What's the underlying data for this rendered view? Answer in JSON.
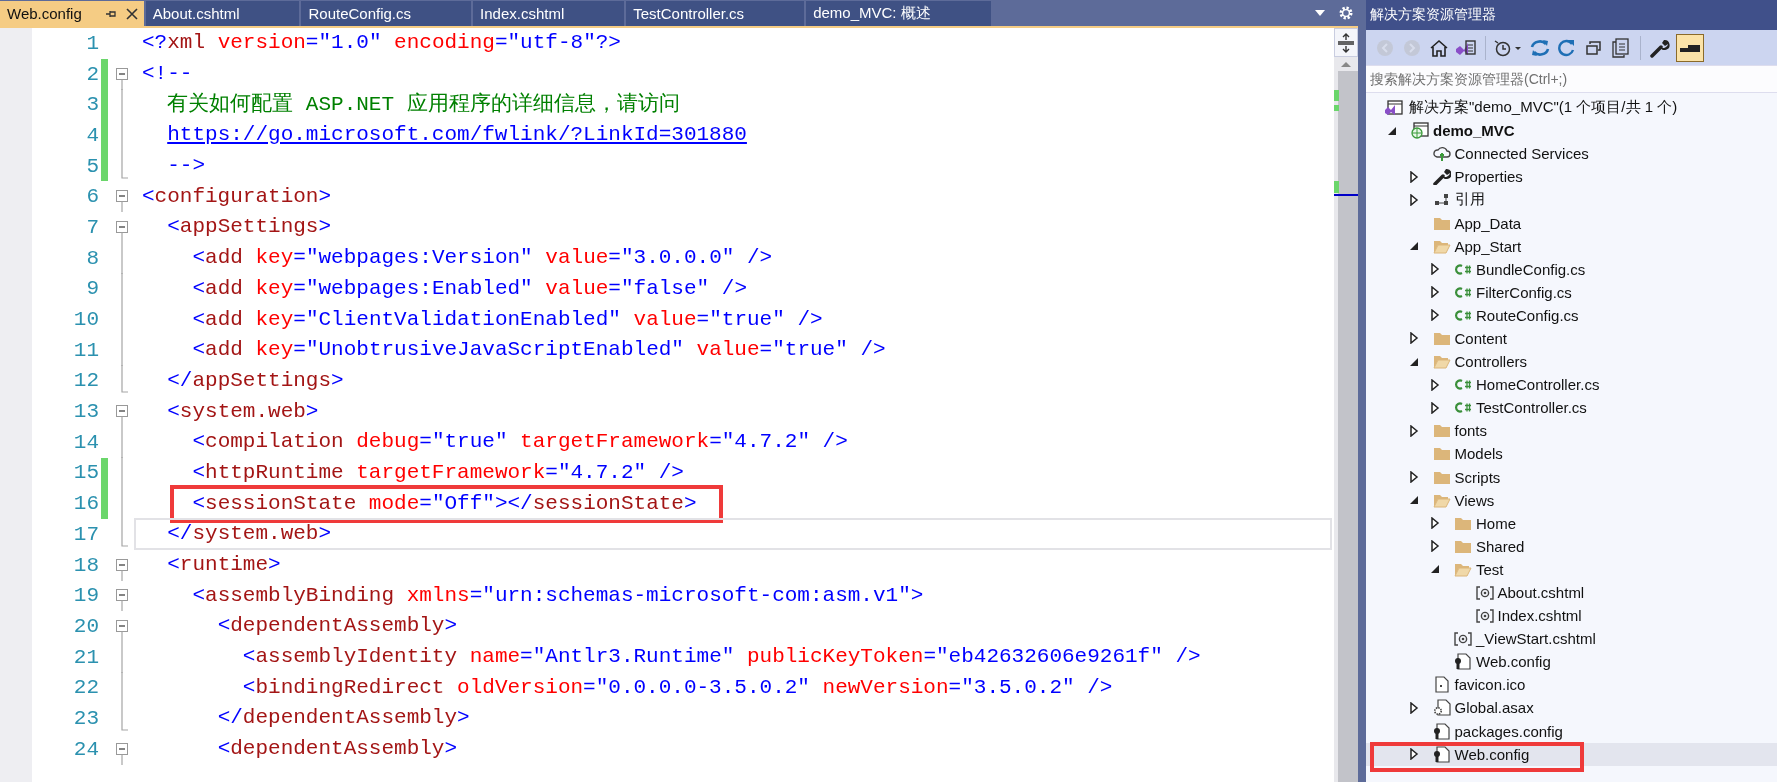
{
  "tabs": [
    {
      "label": "Web.config",
      "selected": true
    },
    {
      "label": "About.cshtml",
      "selected": false
    },
    {
      "label": "RouteConfig.cs",
      "selected": false
    },
    {
      "label": "Index.cshtml",
      "selected": false
    },
    {
      "label": "TestController.cs",
      "selected": false
    },
    {
      "label": "demo_MVC: 概述",
      "selected": false
    }
  ],
  "editor": {
    "lines": [
      {
        "number": "1",
        "changed": false,
        "kind": "plain",
        "current": false,
        "highlighted": false,
        "tokens": [
          {
            "kind": "delim",
            "text": "<?"
          },
          {
            "kind": "tag",
            "text": "xml"
          },
          {
            "kind": "attr",
            "text": " version"
          },
          {
            "kind": "delim",
            "text": "="
          },
          {
            "kind": "value",
            "text": "\"1.0\""
          },
          {
            "kind": "attr",
            "text": " encoding"
          },
          {
            "kind": "delim",
            "text": "="
          },
          {
            "kind": "value",
            "text": "\"utf-8\""
          },
          {
            "kind": "delim",
            "text": "?>"
          }
        ]
      },
      {
        "number": "2",
        "changed": true,
        "kind": "fold-start",
        "current": false,
        "highlighted": false,
        "tokens": [
          {
            "kind": "delim",
            "text": "<!--"
          }
        ]
      },
      {
        "number": "3",
        "changed": true,
        "kind": "fold-body",
        "current": false,
        "highlighted": false,
        "tokens": [
          {
            "kind": "comment",
            "text": "  有关如何配置 ASP.NET 应用程序的详细信息，请访问"
          }
        ]
      },
      {
        "number": "4",
        "changed": true,
        "kind": "fold-body",
        "current": false,
        "highlighted": false,
        "tokens": [
          {
            "kind": "link",
            "text": "  https://go.microsoft.com/fwlink/?LinkId=301880"
          }
        ]
      },
      {
        "number": "5",
        "changed": true,
        "kind": "fold-end",
        "current": false,
        "highlighted": false,
        "tokens": [
          {
            "kind": "delim",
            "text": "  -->"
          }
        ]
      },
      {
        "number": "6",
        "changed": false,
        "kind": "fold-start",
        "current": false,
        "highlighted": false,
        "tokens": [
          {
            "kind": "delim",
            "text": "<"
          },
          {
            "kind": "tag",
            "text": "configuration"
          },
          {
            "kind": "delim",
            "text": ">"
          }
        ]
      },
      {
        "number": "7",
        "changed": false,
        "kind": "fold-start",
        "current": false,
        "highlighted": false,
        "tokens": [
          {
            "kind": "delim",
            "text": "  <"
          },
          {
            "kind": "tag",
            "text": "appSettings"
          },
          {
            "kind": "delim",
            "text": ">"
          }
        ]
      },
      {
        "number": "8",
        "changed": false,
        "kind": "fold-body",
        "current": false,
        "highlighted": false,
        "tokens": [
          {
            "kind": "delim",
            "text": "    <"
          },
          {
            "kind": "tag",
            "text": "add"
          },
          {
            "kind": "attr",
            "text": " key"
          },
          {
            "kind": "delim",
            "text": "="
          },
          {
            "kind": "value",
            "text": "\"webpages:Version\""
          },
          {
            "kind": "attr",
            "text": " value"
          },
          {
            "kind": "delim",
            "text": "="
          },
          {
            "kind": "value",
            "text": "\"3.0.0.0\""
          },
          {
            "kind": "delim",
            "text": " />"
          }
        ]
      },
      {
        "number": "9",
        "changed": false,
        "kind": "fold-body",
        "current": false,
        "highlighted": false,
        "tokens": [
          {
            "kind": "delim",
            "text": "    <"
          },
          {
            "kind": "tag",
            "text": "add"
          },
          {
            "kind": "attr",
            "text": " key"
          },
          {
            "kind": "delim",
            "text": "="
          },
          {
            "kind": "value",
            "text": "\"webpages:Enabled\""
          },
          {
            "kind": "attr",
            "text": " value"
          },
          {
            "kind": "delim",
            "text": "="
          },
          {
            "kind": "value",
            "text": "\"false\""
          },
          {
            "kind": "delim",
            "text": " />"
          }
        ]
      },
      {
        "number": "10",
        "changed": false,
        "kind": "fold-body",
        "current": false,
        "highlighted": false,
        "tokens": [
          {
            "kind": "delim",
            "text": "    <"
          },
          {
            "kind": "tag",
            "text": "add"
          },
          {
            "kind": "attr",
            "text": " key"
          },
          {
            "kind": "delim",
            "text": "="
          },
          {
            "kind": "value",
            "text": "\"ClientValidationEnabled\""
          },
          {
            "kind": "attr",
            "text": " value"
          },
          {
            "kind": "delim",
            "text": "="
          },
          {
            "kind": "value",
            "text": "\"true\""
          },
          {
            "kind": "delim",
            "text": " />"
          }
        ]
      },
      {
        "number": "11",
        "changed": false,
        "kind": "fold-body",
        "current": false,
        "highlighted": false,
        "tokens": [
          {
            "kind": "delim",
            "text": "    <"
          },
          {
            "kind": "tag",
            "text": "add"
          },
          {
            "kind": "attr",
            "text": " key"
          },
          {
            "kind": "delim",
            "text": "="
          },
          {
            "kind": "value",
            "text": "\"UnobtrusiveJavaScriptEnabled\""
          },
          {
            "kind": "attr",
            "text": " value"
          },
          {
            "kind": "delim",
            "text": "="
          },
          {
            "kind": "value",
            "text": "\"true\""
          },
          {
            "kind": "delim",
            "text": " />"
          }
        ]
      },
      {
        "number": "12",
        "changed": false,
        "kind": "fold-end",
        "current": false,
        "highlighted": false,
        "tokens": [
          {
            "kind": "delim",
            "text": "  </"
          },
          {
            "kind": "tag",
            "text": "appSettings"
          },
          {
            "kind": "delim",
            "text": ">"
          }
        ]
      },
      {
        "number": "13",
        "changed": false,
        "kind": "fold-start",
        "current": false,
        "highlighted": false,
        "tokens": [
          {
            "kind": "delim",
            "text": "  <"
          },
          {
            "kind": "tag",
            "text": "system.web"
          },
          {
            "kind": "delim",
            "text": ">"
          }
        ]
      },
      {
        "number": "14",
        "changed": false,
        "kind": "fold-body",
        "current": false,
        "highlighted": false,
        "tokens": [
          {
            "kind": "delim",
            "text": "    <"
          },
          {
            "kind": "tag",
            "text": "compilation"
          },
          {
            "kind": "attr",
            "text": " debug"
          },
          {
            "kind": "delim",
            "text": "="
          },
          {
            "kind": "value",
            "text": "\"true\""
          },
          {
            "kind": "attr",
            "text": " targetFramework"
          },
          {
            "kind": "delim",
            "text": "="
          },
          {
            "kind": "value",
            "text": "\"4.7.2\""
          },
          {
            "kind": "delim",
            "text": " />"
          }
        ]
      },
      {
        "number": "15",
        "changed": true,
        "kind": "fold-body",
        "current": false,
        "highlighted": false,
        "tokens": [
          {
            "kind": "delim",
            "text": "    <"
          },
          {
            "kind": "tag",
            "text": "httpRuntime"
          },
          {
            "kind": "attr",
            "text": " targetFramework"
          },
          {
            "kind": "delim",
            "text": "="
          },
          {
            "kind": "value",
            "text": "\"4.7.2\""
          },
          {
            "kind": "delim",
            "text": " />"
          }
        ]
      },
      {
        "number": "16",
        "changed": true,
        "kind": "fold-body",
        "current": false,
        "highlighted": true,
        "tokens": [
          {
            "kind": "delim",
            "text": "    <"
          },
          {
            "kind": "tag",
            "text": "sessionState"
          },
          {
            "kind": "attr",
            "text": " mode"
          },
          {
            "kind": "delim",
            "text": "="
          },
          {
            "kind": "value",
            "text": "\"Off\""
          },
          {
            "kind": "delim",
            "text": "></"
          },
          {
            "kind": "tag",
            "text": "sessionState"
          },
          {
            "kind": "delim",
            "text": ">"
          }
        ]
      },
      {
        "number": "17",
        "changed": false,
        "kind": "fold-end",
        "current": true,
        "highlighted": false,
        "tokens": [
          {
            "kind": "delim",
            "text": "  </"
          },
          {
            "kind": "tag",
            "text": "system.web"
          },
          {
            "kind": "delim",
            "text": ">"
          }
        ]
      },
      {
        "number": "18",
        "changed": false,
        "kind": "fold-start",
        "current": false,
        "highlighted": false,
        "tokens": [
          {
            "kind": "delim",
            "text": "  <"
          },
          {
            "kind": "tag",
            "text": "runtime"
          },
          {
            "kind": "delim",
            "text": ">"
          }
        ]
      },
      {
        "number": "19",
        "changed": false,
        "kind": "fold-start",
        "current": false,
        "highlighted": false,
        "tokens": [
          {
            "kind": "delim",
            "text": "    <"
          },
          {
            "kind": "tag",
            "text": "assemblyBinding"
          },
          {
            "kind": "attr",
            "text": " xmlns"
          },
          {
            "kind": "delim",
            "text": "="
          },
          {
            "kind": "value",
            "text": "\"urn:schemas-microsoft-com:asm.v1\""
          },
          {
            "kind": "delim",
            "text": ">"
          }
        ]
      },
      {
        "number": "20",
        "changed": false,
        "kind": "fold-start",
        "current": false,
        "highlighted": false,
        "tokens": [
          {
            "kind": "delim",
            "text": "      <"
          },
          {
            "kind": "tag",
            "text": "dependentAssembly"
          },
          {
            "kind": "delim",
            "text": ">"
          }
        ]
      },
      {
        "number": "21",
        "changed": false,
        "kind": "fold-body",
        "current": false,
        "highlighted": false,
        "tokens": [
          {
            "kind": "delim",
            "text": "        <"
          },
          {
            "kind": "tag",
            "text": "assemblyIdentity"
          },
          {
            "kind": "attr",
            "text": " name"
          },
          {
            "kind": "delim",
            "text": "="
          },
          {
            "kind": "value",
            "text": "\"Antlr3.Runtime\""
          },
          {
            "kind": "attr",
            "text": " publicKeyToken"
          },
          {
            "kind": "delim",
            "text": "="
          },
          {
            "kind": "value",
            "text": "\"eb42632606e9261f\""
          },
          {
            "kind": "delim",
            "text": " />"
          }
        ]
      },
      {
        "number": "22",
        "changed": false,
        "kind": "fold-body",
        "current": false,
        "highlighted": false,
        "tokens": [
          {
            "kind": "delim",
            "text": "        <"
          },
          {
            "kind": "tag",
            "text": "bindingRedirect"
          },
          {
            "kind": "attr",
            "text": " oldVersion"
          },
          {
            "kind": "delim",
            "text": "="
          },
          {
            "kind": "value",
            "text": "\"0.0.0.0-3.5.0.2\""
          },
          {
            "kind": "attr",
            "text": " newVersion"
          },
          {
            "kind": "delim",
            "text": "="
          },
          {
            "kind": "value",
            "text": "\"3.5.0.2\""
          },
          {
            "kind": "delim",
            "text": " />"
          }
        ]
      },
      {
        "number": "23",
        "changed": false,
        "kind": "fold-end",
        "current": false,
        "highlighted": false,
        "tokens": [
          {
            "kind": "delim",
            "text": "      </"
          },
          {
            "kind": "tag",
            "text": "dependentAssembly"
          },
          {
            "kind": "delim",
            "text": ">"
          }
        ]
      },
      {
        "number": "24",
        "changed": false,
        "kind": "fold-start",
        "current": false,
        "highlighted": false,
        "tokens": [
          {
            "kind": "delim",
            "text": "      <"
          },
          {
            "kind": "tag",
            "text": "dependentAssembly"
          },
          {
            "kind": "delim",
            "text": ">"
          }
        ]
      }
    ]
  },
  "explorer": {
    "title": "解决方案资源管理器",
    "toolbar": [
      {
        "kind": "back",
        "disabled": true,
        "selected": false
      },
      {
        "kind": "forward",
        "disabled": true,
        "selected": false
      },
      {
        "kind": "home",
        "disabled": false,
        "selected": false
      },
      {
        "kind": "views",
        "disabled": false,
        "selected": false
      },
      {
        "kind": "separator"
      },
      {
        "kind": "history",
        "disabled": false,
        "selected": false
      },
      {
        "kind": "sync",
        "disabled": false,
        "selected": false
      },
      {
        "kind": "refresh",
        "disabled": false,
        "selected": false
      },
      {
        "kind": "collapse",
        "disabled": false,
        "selected": false
      },
      {
        "kind": "copy",
        "disabled": false,
        "selected": false
      },
      {
        "kind": "separator"
      },
      {
        "kind": "properties",
        "disabled": false,
        "selected": false
      },
      {
        "kind": "preview",
        "disabled": false,
        "selected": true
      }
    ],
    "search": {
      "placeholder": "搜索解决方案资源管理器(Ctrl+;)"
    },
    "solution": {
      "label": "解决方案\"demo_MVC\"(1 个项目/共 1 个)"
    },
    "tree": [
      {
        "label": "demo_MVC",
        "kind": "project",
        "expanded": true,
        "selected": false,
        "highlighted": false,
        "children": [
          {
            "label": "Connected Services",
            "kind": "services",
            "selected": false,
            "highlighted": false
          },
          {
            "label": "Properties",
            "kind": "properties",
            "expanded": false,
            "selected": false,
            "highlighted": false
          },
          {
            "label": "引用",
            "kind": "references",
            "expanded": false,
            "selected": false,
            "highlighted": false
          },
          {
            "label": "App_Data",
            "kind": "folder",
            "selected": false,
            "highlighted": false
          },
          {
            "label": "App_Start",
            "kind": "folder",
            "expanded": true,
            "selected": false,
            "highlighted": false,
            "children": [
              {
                "label": "BundleConfig.cs",
                "kind": "csharp",
                "expanded": false,
                "selected": false,
                "highlighted": false
              },
              {
                "label": "FilterConfig.cs",
                "kind": "csharp",
                "expanded": false,
                "selected": false,
                "highlighted": false
              },
              {
                "label": "RouteConfig.cs",
                "kind": "csharp",
                "expanded": false,
                "selected": false,
                "highlighted": false
              }
            ]
          },
          {
            "label": "Content",
            "kind": "folder",
            "expanded": false,
            "selected": false,
            "highlighted": false
          },
          {
            "label": "Controllers",
            "kind": "folder",
            "expanded": true,
            "selected": false,
            "highlighted": false,
            "children": [
              {
                "label": "HomeController.cs",
                "kind": "csharp",
                "expanded": false,
                "selected": false,
                "highlighted": false
              },
              {
                "label": "TestController.cs",
                "kind": "csharp",
                "expanded": false,
                "selected": false,
                "highlighted": false
              }
            ]
          },
          {
            "label": "fonts",
            "kind": "folder",
            "expanded": false,
            "selected": false,
            "highlighted": false
          },
          {
            "label": "Models",
            "kind": "folder",
            "selected": false,
            "highlighted": false
          },
          {
            "label": "Scripts",
            "kind": "folder",
            "expanded": false,
            "selected": false,
            "highlighted": false
          },
          {
            "label": "Views",
            "kind": "folder",
            "expanded": true,
            "selected": false,
            "highlighted": false,
            "children": [
              {
                "label": "Home",
                "kind": "folder",
                "expanded": false,
                "selected": false,
                "highlighted": false
              },
              {
                "label": "Shared",
                "kind": "folder",
                "expanded": false,
                "selected": false,
                "highlighted": false
              },
              {
                "label": "Test",
                "kind": "folder",
                "expanded": true,
                "selected": false,
                "highlighted": false,
                "children": [
                  {
                    "label": "About.cshtml",
                    "kind": "razor",
                    "selected": false,
                    "highlighted": false
                  },
                  {
                    "label": "Index.cshtml",
                    "kind": "razor",
                    "selected": false,
                    "highlighted": false
                  }
                ]
              },
              {
                "label": "_ViewStart.cshtml",
                "kind": "razor",
                "selected": false,
                "highlighted": false
              },
              {
                "label": "Web.config",
                "kind": "config",
                "selected": false,
                "highlighted": false
              }
            ]
          },
          {
            "label": "favicon.ico",
            "kind": "image",
            "selected": false,
            "highlighted": false
          },
          {
            "label": "Global.asax",
            "kind": "asax",
            "expanded": false,
            "selected": false,
            "highlighted": false
          },
          {
            "label": "packages.config",
            "kind": "config",
            "selected": false,
            "highlighted": false
          },
          {
            "label": "Web.config",
            "kind": "config",
            "expanded": false,
            "selected": true,
            "highlighted": true
          }
        ]
      }
    ]
  }
}
